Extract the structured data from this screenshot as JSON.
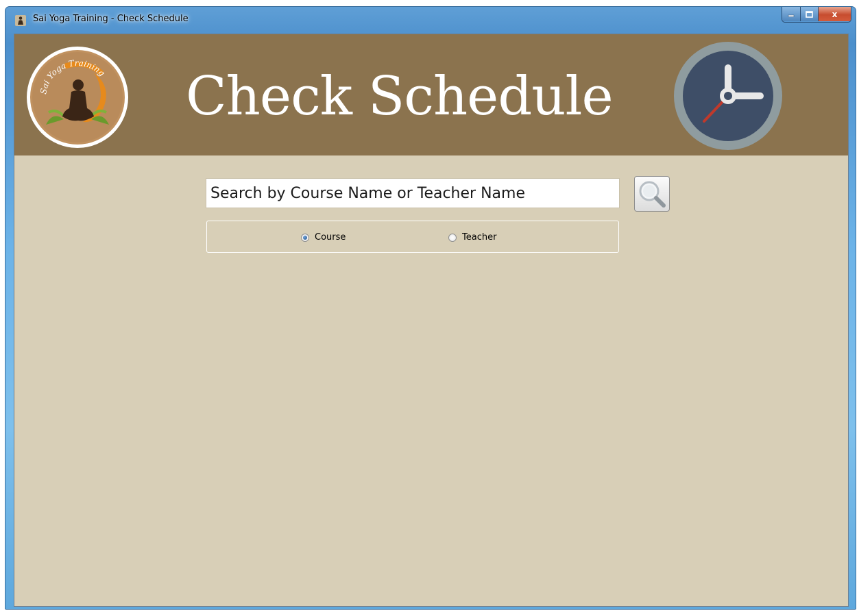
{
  "window": {
    "title": "Sai Yoga Training - Check Schedule",
    "controls": {
      "minimize": "–",
      "maximize": "□",
      "close": "x"
    }
  },
  "header": {
    "title": "Check Schedule",
    "logo_text": "Sai Yoga Training",
    "logo_icon": "meditation-figure-icon",
    "right_icon": "clock-icon"
  },
  "search": {
    "placeholder": "Search by Course Name or Teacher Name",
    "value": "",
    "button_icon": "magnifier-icon"
  },
  "search_type": {
    "options": [
      {
        "label": "Course",
        "checked": true
      },
      {
        "label": "Teacher",
        "checked": false
      }
    ]
  },
  "colors": {
    "header_bg": "#8b734e",
    "body_bg": "#d8cfb7",
    "title_text": "#ffffff",
    "clock_face": "#3d4c66",
    "clock_ring": "#8e9ba0",
    "clock_second_hand": "#c0392b"
  }
}
